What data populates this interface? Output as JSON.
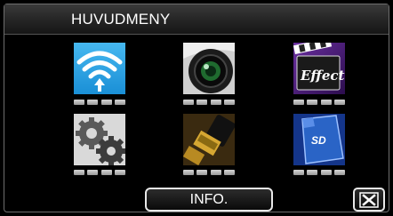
{
  "header": {
    "title": "HUVUDMENY"
  },
  "menu": {
    "items": [
      {
        "icon": "wifi-icon",
        "page_indicator_count": 4
      },
      {
        "icon": "camera-lens-icon",
        "page_indicator_count": 4
      },
      {
        "icon": "effect-clapperboard-icon",
        "page_indicator_count": 4,
        "icon_text": "Effect"
      },
      {
        "icon": "gears-settings-icon",
        "page_indicator_count": 4
      },
      {
        "icon": "hdmi-connector-icon",
        "page_indicator_count": 4
      },
      {
        "icon": "sd-card-icon",
        "page_indicator_count": 4,
        "icon_text": "SD"
      }
    ]
  },
  "footer": {
    "info_label": "INFO.",
    "close_icon": "close-x-icon"
  },
  "colors": {
    "background": "#000000",
    "title_bar": "#242424",
    "text": "#ffffff",
    "wifi_blue": "#1a9be0",
    "sd_blue": "#2a64c6",
    "effect_purple": "#4a1d7a"
  }
}
